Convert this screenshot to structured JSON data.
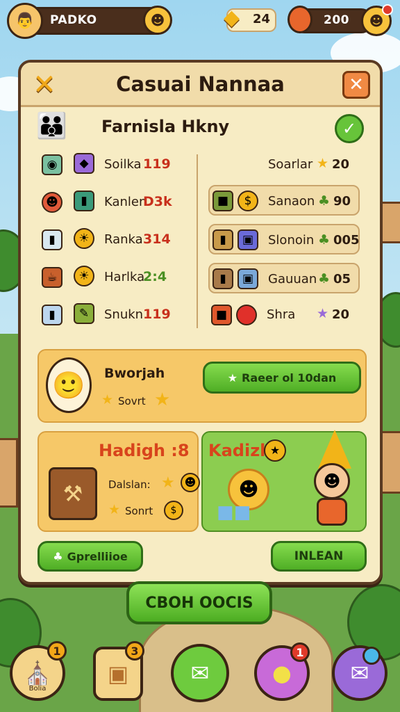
{
  "topbar": {
    "player_name": "PADKO",
    "gems": "24",
    "coins": "200"
  },
  "panel": {
    "title": "Casuai Nannaa",
    "family_name": "Farnisla Hkny"
  },
  "left_list": [
    {
      "label": "Soilka",
      "value": "119"
    },
    {
      "label": "Kanlen",
      "value": "D3k"
    },
    {
      "label": "Ranka",
      "value": "314"
    },
    {
      "label": "Harlka",
      "value": "2:4"
    },
    {
      "label": "Snukn",
      "value": "119"
    }
  ],
  "right_header": {
    "label": "Soarlar",
    "value": "20"
  },
  "right_list": [
    {
      "label": "Sanaon",
      "value": "90"
    },
    {
      "label": "Slonoin",
      "value": "005"
    },
    {
      "label": "Gauuan",
      "value": "05"
    },
    {
      "label": "Shra",
      "value": "20"
    }
  ],
  "promo": {
    "name": "Bworjah",
    "sub": "Sovrt",
    "button": "Raeer ol 10dan"
  },
  "tile_left": {
    "title": "Hadigh :8",
    "line1": "Dalslan:",
    "line2": "Sonrt"
  },
  "tile_right": {
    "title": "Kadizl"
  },
  "actions": {
    "left_button": "Gprelliioe",
    "right_button": "INLEAN",
    "main_button": "CBOH OOCIS"
  },
  "nav": [
    {
      "label": "Bolia",
      "badge": "1"
    },
    {
      "label": "",
      "badge": "3"
    },
    {
      "label": "",
      "badge": ""
    },
    {
      "label": "",
      "badge": "1"
    },
    {
      "label": "",
      "badge": ""
    }
  ],
  "colors": {
    "panel": "#f7ecc4",
    "border": "#5a3a22",
    "accent_green": "#4fae25",
    "accent_orange": "#f08a44",
    "highlight_red": "#c8301c"
  }
}
